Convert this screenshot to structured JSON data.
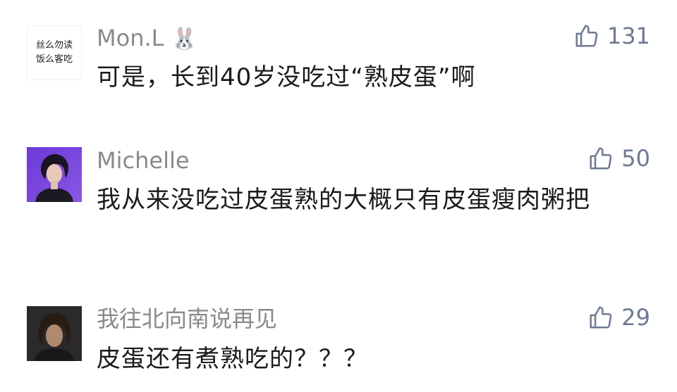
{
  "comments": [
    {
      "username": "Mon.L",
      "username_emoji": "🐰",
      "avatar_text": [
        "丝么勿读",
        "饭么客吃"
      ],
      "content": "可是，长到40岁没吃过“熟皮蛋”啊",
      "likes": "131"
    },
    {
      "username": "Michelle",
      "content": "我从来没吃过皮蛋熟的大概只有皮蛋瘦肉粥把",
      "likes": "50"
    },
    {
      "username": "我往北向南说再见",
      "content": "皮蛋还有煮熟吃的？？？",
      "likes": "29"
    }
  ],
  "colors": {
    "username": "#8a8a8a",
    "content": "#1a1a1a",
    "like": "#6d7a93"
  }
}
